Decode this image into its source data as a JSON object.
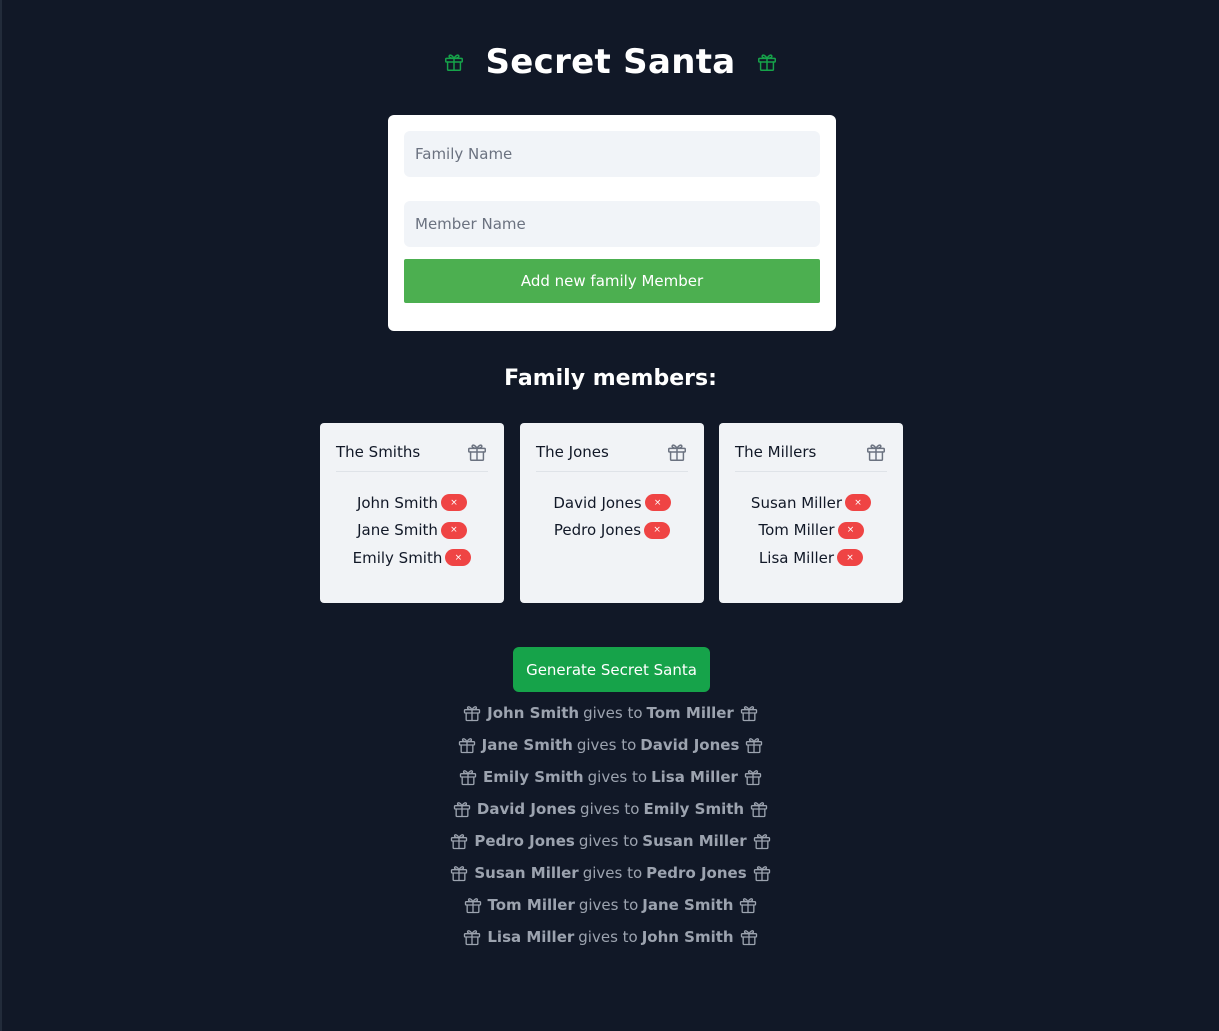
{
  "app": {
    "title": "Secret Santa",
    "accent_green": "#16a34a",
    "background": "#111827"
  },
  "form": {
    "family_placeholder": "Family Name",
    "member_placeholder": "Member Name",
    "add_button_label": "Add new family Member",
    "add_button_color": "#4caf50"
  },
  "families_heading": "Family members:",
  "families": [
    {
      "name": "The Smiths",
      "members": [
        "John Smith",
        "Jane Smith",
        "Emily Smith"
      ]
    },
    {
      "name": "The Jones",
      "members": [
        "David Jones",
        "Pedro Jones"
      ]
    },
    {
      "name": "The Millers",
      "members": [
        "Susan Miller",
        "Tom Miller",
        "Lisa Miller"
      ]
    }
  ],
  "remove_glyph": "×",
  "generate_button_label": "Generate Secret Santa",
  "gives_to_text": "gives to",
  "pairings": [
    {
      "giver": "John Smith",
      "receiver": "Tom Miller"
    },
    {
      "giver": "Jane Smith",
      "receiver": "David Jones"
    },
    {
      "giver": "Emily Smith",
      "receiver": "Lisa Miller"
    },
    {
      "giver": "David Jones",
      "receiver": "Emily Smith"
    },
    {
      "giver": "Pedro Jones",
      "receiver": "Susan Miller"
    },
    {
      "giver": "Susan Miller",
      "receiver": "Pedro Jones"
    },
    {
      "giver": "Tom Miller",
      "receiver": "Jane Smith"
    },
    {
      "giver": "Lisa Miller",
      "receiver": "John Smith"
    }
  ],
  "icons": {
    "title_icon": "gift-icon",
    "card_icon": "gift-icon",
    "pair_icon": "gift-icon"
  }
}
